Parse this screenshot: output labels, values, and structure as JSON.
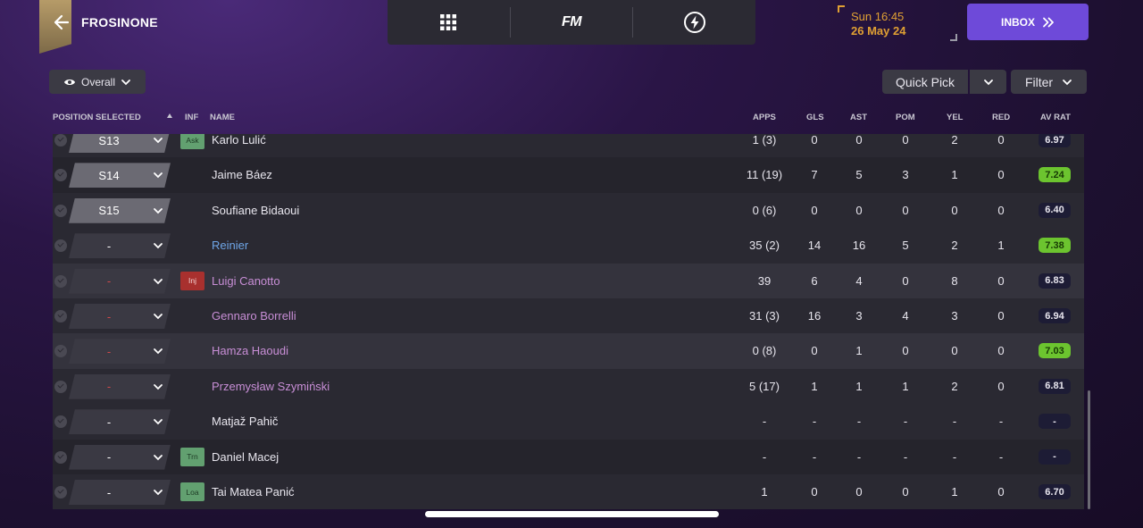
{
  "header": {
    "club": "FROSINONE",
    "nav_logo": "FM",
    "date_time": "Sun 16:45",
    "date_day": "26 May 24",
    "inbox_label": "INBOX"
  },
  "toolbar": {
    "view_label": "Overall",
    "quick_pick_label": "Quick Pick",
    "filter_label": "Filter"
  },
  "table": {
    "columns": {
      "position": "POSITION SELECTED",
      "inf": "INF",
      "name": "NAME",
      "apps": "APPS",
      "gls": "GLS",
      "ast": "AST",
      "pom": "POM",
      "yel": "YEL",
      "red": "RED",
      "avrat": "AV RAT"
    },
    "rows": [
      {
        "pos": "S13",
        "inf": "Ask",
        "name": "Karlo Lulić",
        "apps": "1 (3)",
        "gls": "0",
        "ast": "0",
        "pom": "0",
        "yel": "2",
        "red": "0",
        "rat": "6.97"
      },
      {
        "pos": "S14",
        "inf": "",
        "name": "Jaime Báez",
        "apps": "11 (19)",
        "gls": "7",
        "ast": "5",
        "pom": "3",
        "yel": "1",
        "red": "0",
        "rat": "7.24"
      },
      {
        "pos": "S15",
        "inf": "",
        "name": "Soufiane Bidaoui",
        "apps": "0 (6)",
        "gls": "0",
        "ast": "0",
        "pom": "0",
        "yel": "0",
        "red": "0",
        "rat": "6.40"
      },
      {
        "pos": "-",
        "inf": "",
        "name": "Reinier",
        "apps": "35 (2)",
        "gls": "14",
        "ast": "16",
        "pom": "5",
        "yel": "2",
        "red": "1",
        "rat": "7.38"
      },
      {
        "pos": "-",
        "inf": "Inj",
        "name": "Luigi Canotto",
        "apps": "39",
        "gls": "6",
        "ast": "4",
        "pom": "0",
        "yel": "8",
        "red": "0",
        "rat": "6.83"
      },
      {
        "pos": "-",
        "inf": "",
        "name": "Gennaro Borrelli",
        "apps": "31 (3)",
        "gls": "16",
        "ast": "3",
        "pom": "4",
        "yel": "3",
        "red": "0",
        "rat": "6.94"
      },
      {
        "pos": "-",
        "inf": "",
        "name": "Hamza Haoudi",
        "apps": "0 (8)",
        "gls": "0",
        "ast": "1",
        "pom": "0",
        "yel": "0",
        "red": "0",
        "rat": "7.03"
      },
      {
        "pos": "-",
        "inf": "",
        "name": "Przemysław Szymiński",
        "apps": "5 (17)",
        "gls": "1",
        "ast": "1",
        "pom": "1",
        "yel": "2",
        "red": "0",
        "rat": "6.81"
      },
      {
        "pos": "-",
        "inf": "",
        "name": "Matjaž Pahič",
        "apps": "-",
        "gls": "-",
        "ast": "-",
        "pom": "-",
        "yel": "-",
        "red": "-",
        "rat": "-"
      },
      {
        "pos": "-",
        "inf": "Trn",
        "name": "Daniel Macej",
        "apps": "-",
        "gls": "-",
        "ast": "-",
        "pom": "-",
        "yel": "-",
        "red": "-",
        "rat": "-"
      },
      {
        "pos": "-",
        "inf": "Loa",
        "name": "Tai Matea Panić",
        "apps": "1",
        "gls": "0",
        "ast": "0",
        "pom": "0",
        "yel": "1",
        "red": "0",
        "rat": "6.70"
      }
    ]
  },
  "colors": {
    "accent": "#6e4ad9",
    "date": "#e0a033",
    "rating_good": "#6cc42f",
    "rating_normal": "#1d1c35"
  },
  "icons": {
    "back": "arrow-left-icon",
    "grid": "grid-icon",
    "lightning": "lightning-icon",
    "eye": "eye-icon",
    "chevron": "chevron-down-icon",
    "double_chevron": "double-chevron-right-icon"
  }
}
